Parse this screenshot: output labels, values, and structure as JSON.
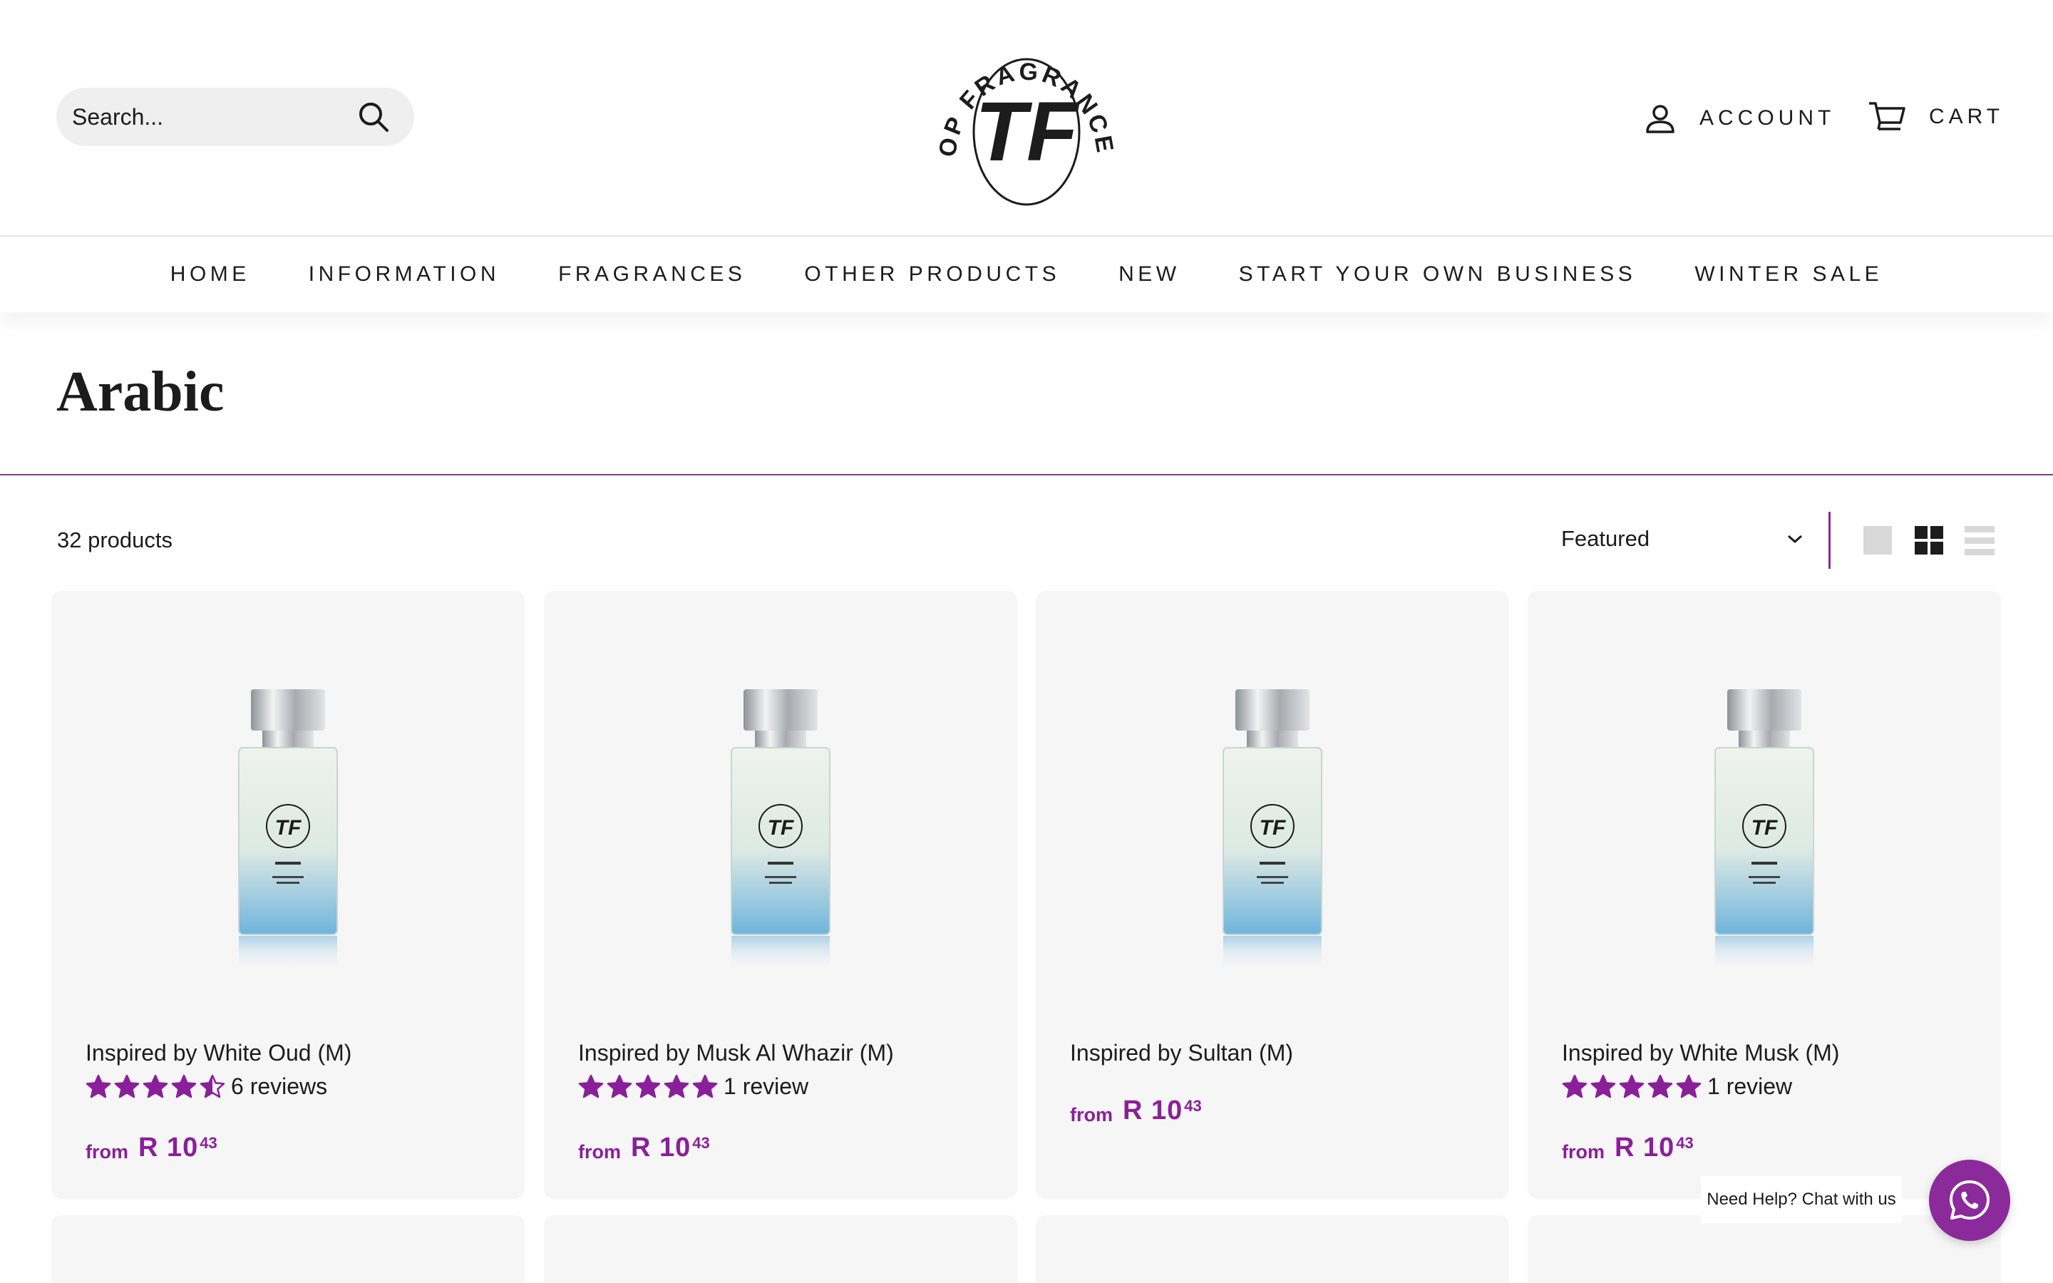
{
  "header": {
    "search_placeholder": "Search...",
    "logo_text": "TOP FRAGRANCES",
    "logo_mark": "TF",
    "account_label": "ACCOUNT",
    "cart_label": "CART"
  },
  "nav": {
    "items": [
      "HOME",
      "INFORMATION",
      "FRAGRANCES",
      "OTHER PRODUCTS",
      "NEW",
      "START YOUR OWN BUSINESS",
      "WINTER SALE"
    ]
  },
  "collection": {
    "title": "Arabic",
    "count": "32 products",
    "sort_value": "Featured"
  },
  "products": [
    {
      "name": "Inspired by White Oud (M)",
      "rating": 4.5,
      "reviews": "6 reviews",
      "from": "from",
      "price": "R 10",
      "cents": "43"
    },
    {
      "name": "Inspired by Musk Al Whazir (M)",
      "rating": 5,
      "reviews": "1 review",
      "from": "from",
      "price": "R 10",
      "cents": "43"
    },
    {
      "name": "Inspired by Sultan (M)",
      "rating": null,
      "reviews": "",
      "from": "from",
      "price": "R 10",
      "cents": "43"
    },
    {
      "name": "Inspired by White Musk (M)",
      "rating": 5,
      "reviews": "1 review",
      "from": "from",
      "price": "R 10",
      "cents": "43"
    }
  ],
  "chat": {
    "label": "Need Help? Chat with us"
  },
  "colors": {
    "accent": "#8a1f9a",
    "divider": "#8a3b8e",
    "card_bg": "#f6f6f6"
  }
}
